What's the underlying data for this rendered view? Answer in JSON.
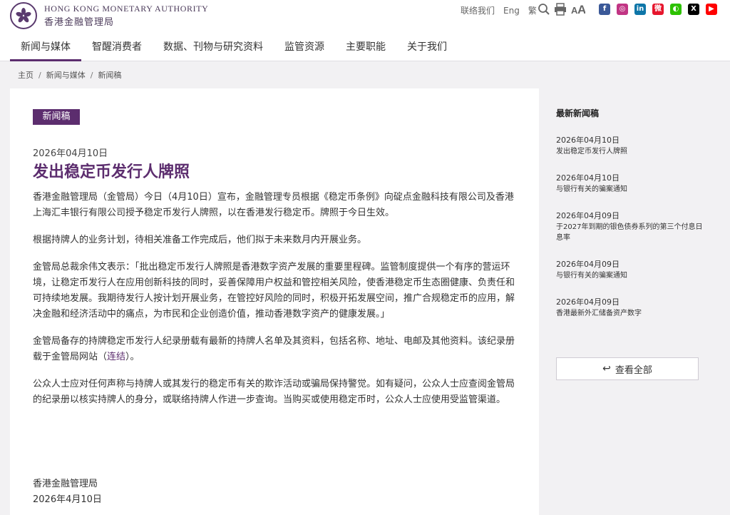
{
  "brand": {
    "en": "HONG KONG MONETARY AUTHORITY",
    "zh": "香港金融管理局"
  },
  "toplinks": {
    "contact": "联络我们",
    "lang_en": "Eng",
    "lang_tc": "繁"
  },
  "tools": [
    "search-icon",
    "print-icon",
    "font-size-icon"
  ],
  "social": [
    {
      "name": "facebook-icon",
      "color": "#3b5998",
      "glyph": "f"
    },
    {
      "name": "instagram-icon",
      "color": "#c13584",
      "glyph": "◎"
    },
    {
      "name": "linkedin-icon",
      "color": "#0e76a8",
      "glyph": "in"
    },
    {
      "name": "weibo-icon",
      "color": "#e6162d",
      "glyph": "微"
    },
    {
      "name": "wechat-icon",
      "color": "#2dc100",
      "glyph": "◐"
    },
    {
      "name": "x-icon",
      "color": "#000000",
      "glyph": "X"
    },
    {
      "name": "youtube-icon",
      "color": "#ff0000",
      "glyph": "▶"
    }
  ],
  "nav": [
    {
      "label": "新闻与媒体",
      "active": true
    },
    {
      "label": "智醒消费者"
    },
    {
      "label": "数据、刊物与研究资料"
    },
    {
      "label": "监管资源"
    },
    {
      "label": "主要职能"
    },
    {
      "label": "关于我们"
    }
  ],
  "breadcrumb": [
    "主页",
    "新闻与媒体",
    "新闻稿"
  ],
  "article": {
    "tag": "新闻稿",
    "date": "2026年04月10日",
    "title": "发出稳定币发行人牌照",
    "p1": "香港金融管理局（金管局）今日（4月10日）宣布，金融管理专员根据《稳定币条例》向碇点金融科技有限公司及香港上海汇丰银行有限公司授予稳定币发行人牌照，以在香港发行稳定币。牌照于今日生效。",
    "p2": "根据持牌人的业务计划，待相关准备工作完成后，他们拟于未来数月内开展业务。",
    "p3": "金管局总裁余伟文表示：「批出稳定币发行人牌照是香港数字资产发展的重要里程碑。监管制度提供一个有序的营运环境，让稳定币发行人在应用创新科技的同时，妥善保障用户权益和管控相关风险，使香港稳定币生态圈健康、负责任和可持续地发展。我期待发行人按计划开展业务，在管控好风险的同时，积极开拓发展空间，推广合规稳定币的应用，解决金融和经济活动中的痛点，为市民和企业创造价值，推动香港数字资产的健康发展。」",
    "p4_a": "金管局备存的持牌稳定币发行人纪录册载有最新的持牌人名单及其资料，包括名称、地址、电邮及其他资料。该纪录册载于金管局网站（",
    "p4_link": "连结",
    "p4_b": "）。",
    "p5": "公众人士应对任何声称与持牌人或其发行的稳定币有关的欺诈活动或骗局保持警觉。如有疑问，公众人士应查阅金管局的纪录册以核实持牌人的身分，或联络持牌人作进一步查询。当购买或使用稳定币时，公众人士应使用受监管渠道。",
    "sign_org": "香港金融管理局",
    "sign_date": "2026年4月10日"
  },
  "sidebar": {
    "title": "最新新闻稿",
    "items": [
      {
        "date": "2026年04月10日",
        "text": "发出稳定币发行人牌照"
      },
      {
        "date": "2026年04月10日",
        "text": "与银行有关的骗案通知"
      },
      {
        "date": "2026年04月09日",
        "text": "于2027年到期的银色债券系列的第三个付息日息率"
      },
      {
        "date": "2026年04月09日",
        "text": "与银行有关的骗案通知"
      },
      {
        "date": "2026年04月09日",
        "text": "香港最新外汇储备资产数字"
      }
    ],
    "view_all": "查看全部"
  },
  "colors": {
    "brand": "#5c2d6e"
  }
}
